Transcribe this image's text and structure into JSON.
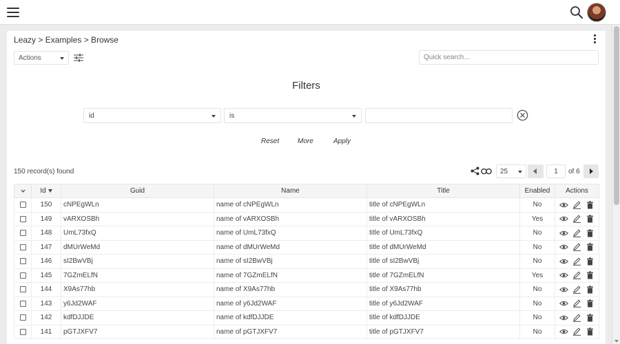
{
  "header": {
    "menu_icon": "hamburger-icon",
    "search_icon": "search-icon",
    "avatar_icon": "user-avatar"
  },
  "breadcrumb": "Leazy > Examples > Browse",
  "toolbar": {
    "actions_label": "Actions",
    "filter_icon": "sliders-icon",
    "quick_search_placeholder": "Quick search..."
  },
  "filters": {
    "title": "Filters",
    "field": "id",
    "operator": "is",
    "value": "",
    "reset_label": "Reset",
    "more_label": "More",
    "apply_label": "Apply"
  },
  "pagination": {
    "records_found": "150 record(s) found",
    "per_page": "25",
    "current_page": "1",
    "total_label": "of 6"
  },
  "table": {
    "columns": {
      "id": "Id",
      "guid": "Guid",
      "name": "Name",
      "title": "Title",
      "enabled": "Enabled",
      "actions": "Actions"
    },
    "rows": [
      {
        "id": "150",
        "guid": "cNPEgWLn",
        "name": "name of cNPEgWLn",
        "title": "title of cNPEgWLn",
        "enabled": "No"
      },
      {
        "id": "149",
        "guid": "vARXOSBh",
        "name": "name of vARXOSBh",
        "title": "title of vARXOSBh",
        "enabled": "Yes"
      },
      {
        "id": "148",
        "guid": "UmL73fxQ",
        "name": "name of UmL73fxQ",
        "title": "title of UmL73fxQ",
        "enabled": "No"
      },
      {
        "id": "147",
        "guid": "dMUrWeMd",
        "name": "name of dMUrWeMd",
        "title": "title of dMUrWeMd",
        "enabled": "No"
      },
      {
        "id": "146",
        "guid": "sI2BwVBj",
        "name": "name of sI2BwVBj",
        "title": "title of sI2BwVBj",
        "enabled": "No"
      },
      {
        "id": "145",
        "guid": "7GZmELfN",
        "name": "name of 7GZmELfN",
        "title": "title of 7GZmELfN",
        "enabled": "Yes"
      },
      {
        "id": "144",
        "guid": "X9As77hb",
        "name": "name of X9As77hb",
        "title": "title of X9As77hb",
        "enabled": "No"
      },
      {
        "id": "143",
        "guid": "y6Jd2WAF",
        "name": "name of y6Jd2WAF",
        "title": "title of y6Jd2WAF",
        "enabled": "No"
      },
      {
        "id": "142",
        "guid": "kdfDJJDE",
        "name": "name of kdfDJJDE",
        "title": "title of kdfDJJDE",
        "enabled": "No"
      },
      {
        "id": "141",
        "guid": "pGTJXFV7",
        "name": "name of pGTJXFV7",
        "title": "title of pGTJXFV7",
        "enabled": "No"
      }
    ]
  }
}
